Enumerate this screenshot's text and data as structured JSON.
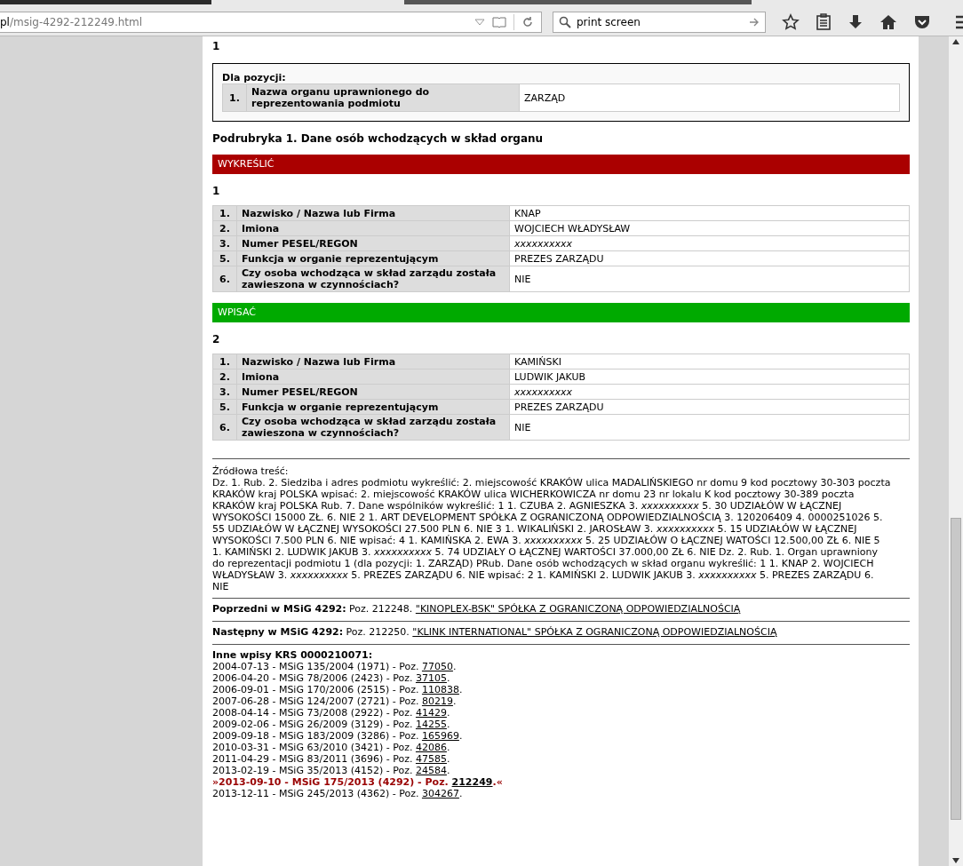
{
  "browser": {
    "url_host": "pl",
    "url_path": "/msig-4292-212249.html",
    "search_value": "print screen"
  },
  "top_number": "1",
  "position_box": {
    "title": "Dla pozycji:",
    "rows": [
      {
        "num": "1.",
        "label": "Nazwa organu uprawnionego do reprezentowania podmiotu",
        "value": "ZARZĄD"
      }
    ]
  },
  "subheading": "Podrubryka 1. Dane osób wchodzących w skład organu",
  "groups": [
    {
      "action": "WYKREŚLIĆ",
      "kind": "remove",
      "number": "1",
      "rows": [
        {
          "num": "1.",
          "label": "Nazwisko / Nazwa lub Firma",
          "value": "KNAP",
          "italic": false
        },
        {
          "num": "2.",
          "label": "Imiona",
          "value": "WOJCIECH WŁADYSŁAW",
          "italic": false
        },
        {
          "num": "3.",
          "label": "Numer PESEL/REGON",
          "value": "xxxxxxxxxx",
          "italic": true
        },
        {
          "num": "5.",
          "label": "Funkcja w organie reprezentującym",
          "value": "PREZES ZARZĄDU",
          "italic": false
        },
        {
          "num": "6.",
          "label": "Czy osoba wchodząca w skład zarządu została zawieszona w czynnościach?",
          "value": "NIE",
          "italic": false
        }
      ]
    },
    {
      "action": "WPISAĆ",
      "kind": "add",
      "number": "2",
      "rows": [
        {
          "num": "1.",
          "label": "Nazwisko / Nazwa lub Firma",
          "value": "KAMIŃSKI",
          "italic": false
        },
        {
          "num": "2.",
          "label": "Imiona",
          "value": "LUDWIK JAKUB",
          "italic": false
        },
        {
          "num": "3.",
          "label": "Numer PESEL/REGON",
          "value": "xxxxxxxxxx",
          "italic": true
        },
        {
          "num": "5.",
          "label": "Funkcja w organie reprezentującym",
          "value": "PREZES ZARZĄDU",
          "italic": false
        },
        {
          "num": "6.",
          "label": "Czy osoba wchodząca w skład zarządu została zawieszona w czynnościach?",
          "value": "NIE",
          "italic": false
        }
      ]
    }
  ],
  "source": {
    "title": "Źródłowa treść:",
    "text": "Dz. 1. Rub. 2. Siedziba i adres podmiotu wykreślić: 2. miejscowość KRAKÓW ulica MADALIŃSKIEGO nr domu 9 kod pocztowy 30-303 poczta KRAKÓW kraj POLSKA wpisać: 2. miejscowość KRAKÓW ulica WICHERKOWICZA nr domu 23 nr lokalu K kod pocztowy 30-389 poczta KRAKÓW kraj POLSKA Rub. 7. Dane wspólników wykreślić: 1 1. CZUBA 2. AGNIESZKA 3. *xxxxxxxxxx* 5. 30 UDZIAŁÓW W ŁĄCZNEJ WYSOKOŚCI 15000 ZŁ. 6. NIE 2 1. ART DEVELOPMENT SPÓŁKA Z OGRANICZONĄ ODPOWIEDZIALNOŚCIĄ 3. 120206409 4. 0000251026 5. 55 UDZIAŁÓW W ŁĄCZNEJ WYSOKOŚCI 27.500 PLN 6. NIE 3 1. WIKALIŃSKI 2. JAROSŁAW 3. *xxxxxxxxxx* 5. 15 UDZIAŁÓW W ŁĄCZNEJ WYSOKOŚCI 7.500 PLN 6. NIE wpisać: 4 1. KAMIŃSKA 2. EWA 3. *xxxxxxxxxx* 5. 25 UDZIAŁÓW O ŁĄCZNEJ WATOŚCI 12.500,00 ZŁ 6. NIE 5 1. KAMIŃSKI 2. LUDWIK JAKUB 3. *xxxxxxxxxx* 5. 74 UDZIAŁY O ŁĄCZNEJ WARTOŚCI 37.000,00 ZŁ 6. NIE Dz. 2. Rub. 1. Organ uprawniony do reprezentacji podmiotu 1 (dla pozycji: 1. ZARZĄD) PRub. Dane osób wchodzących w skład organu wykreślić: 1 1. KNAP 2. WOJCIECH WŁADYSŁAW 3. *xxxxxxxxxx* 5. PREZES ZARZĄDU 6. NIE wpisać: 2 1. KAMIŃSKI 2. LUDWIK JAKUB 3. *xxxxxxxxxx* 5. PREZES ZARZĄDU 6. NIE"
  },
  "neighbors": [
    {
      "label": "Poprzedni w MSiG 4292:",
      "text": "Poz. 212248.",
      "link": "\"KINOPLEX-BSK\" SPÓŁKA Z OGRANICZONĄ ODPOWIEDZIALNOŚCIĄ"
    },
    {
      "label": "Następny w MSiG 4292:",
      "text": "Poz. 212250.",
      "link": "\"KLINK INTERNATIONAL\" SPÓŁKA Z OGRANICZONĄ ODPOWIEDZIALNOŚCIĄ"
    }
  ],
  "other": {
    "title": "Inne wpisy KRS 0000210071:",
    "entries": [
      {
        "text": "2004-07-13 - MSiG 135/2004 (1971) - Poz.",
        "link": "77050",
        "end": ".",
        "selected": false
      },
      {
        "text": "2006-04-20 - MSiG 78/2006 (2423) - Poz.",
        "link": "37105",
        "end": ".",
        "selected": false
      },
      {
        "text": "2006-09-01 - MSiG 170/2006 (2515) - Poz.",
        "link": "110838",
        "end": ".",
        "selected": false
      },
      {
        "text": "2007-06-28 - MSiG 124/2007 (2721) - Poz.",
        "link": "80219",
        "end": ".",
        "selected": false
      },
      {
        "text": "2008-04-14 - MSiG 73/2008 (2922) - Poz.",
        "link": "41429",
        "end": ".",
        "selected": false
      },
      {
        "text": "2009-02-06 - MSiG 26/2009 (3129) - Poz.",
        "link": "14255",
        "end": ".",
        "selected": false
      },
      {
        "text": "2009-09-18 - MSiG 183/2009 (3286) - Poz.",
        "link": "165969",
        "end": ".",
        "selected": false
      },
      {
        "text": "2010-03-31 - MSiG 63/2010 (3421) - Poz.",
        "link": "42086",
        "end": ".",
        "selected": false
      },
      {
        "text": "2011-04-29 - MSiG 83/2011 (3696) - Poz.",
        "link": "47585",
        "end": ".",
        "selected": false
      },
      {
        "text": "2013-02-19 - MSiG 35/2013 (4152) - Poz.",
        "link": "24584",
        "end": ".",
        "selected": false
      },
      {
        "text": "»2013-09-10 - MSiG 175/2013 (4292) - Poz.",
        "link": "212249",
        "end": ".«",
        "selected": true
      },
      {
        "text": "2013-12-11 - MSiG 245/2013 (4362) - Poz.",
        "link": "304267",
        "end": ".",
        "selected": false
      }
    ]
  }
}
